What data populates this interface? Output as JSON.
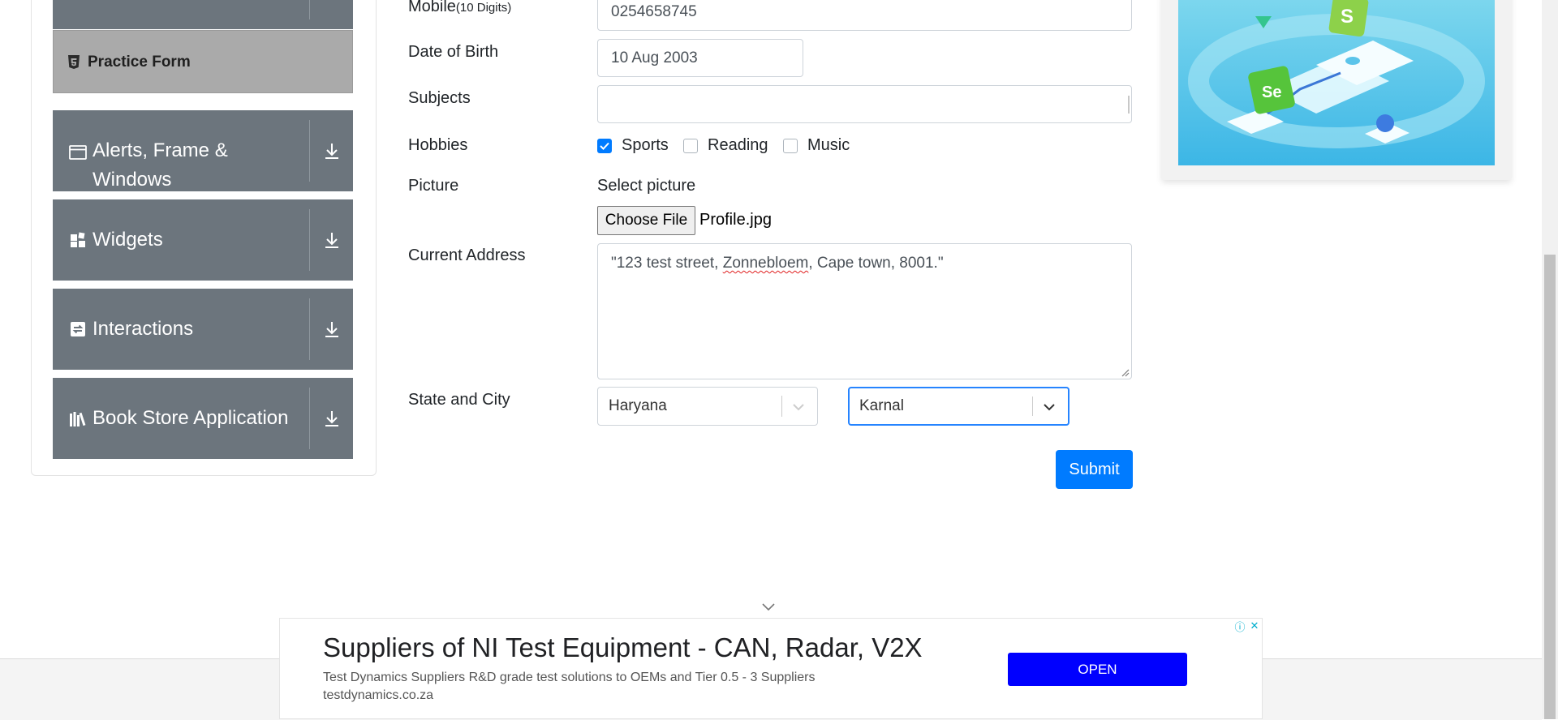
{
  "sidebar": {
    "active_item": {
      "label": "Practice Form",
      "icon": "html5-icon"
    },
    "groups": [
      {
        "title": "Alerts, Frame & Windows",
        "icon": "window-icon"
      },
      {
        "title": "Widgets",
        "icon": "widgets-icon"
      },
      {
        "title": "Interactions",
        "icon": "interactions-icon"
      },
      {
        "title": "Book Store Application",
        "icon": "books-icon"
      }
    ]
  },
  "form": {
    "mobile": {
      "label": "Mobile",
      "hint": "(10 Digits)",
      "value": "0254658745"
    },
    "dob": {
      "label": "Date of Birth",
      "value": "10 Aug 2003"
    },
    "subjects": {
      "label": "Subjects",
      "value": ""
    },
    "hobbies": {
      "label": "Hobbies",
      "options": [
        {
          "label": "Sports",
          "checked": true
        },
        {
          "label": "Reading",
          "checked": false
        },
        {
          "label": "Music",
          "checked": false
        }
      ]
    },
    "picture": {
      "label": "Picture",
      "select_label": "Select picture",
      "button": "Choose File",
      "file_name": "Profile.jpg"
    },
    "address": {
      "label": "Current Address",
      "value_before": "\"123 test street, ",
      "value_misspelled": "Zonnebloem",
      "value_after": ", Cape town, 8001.\""
    },
    "state_city": {
      "label": "State and City",
      "state": "Haryana",
      "city": "Karnal"
    },
    "submit": "Submit"
  },
  "ad": {
    "title": "Suppliers of NI Test Equipment - CAN, Radar, V2X",
    "description": "Test Dynamics Suppliers R&D grade test solutions to OEMs and Tier 0.5 - 3 Suppliers",
    "url": "testdynamics.co.za",
    "cta": "OPEN"
  },
  "colors": {
    "sidebar_group": "#6c757d",
    "active_item": "#aaaaaa",
    "primary": "#007bff",
    "focus": "#2684ff",
    "ad_button": "#0000ff"
  }
}
